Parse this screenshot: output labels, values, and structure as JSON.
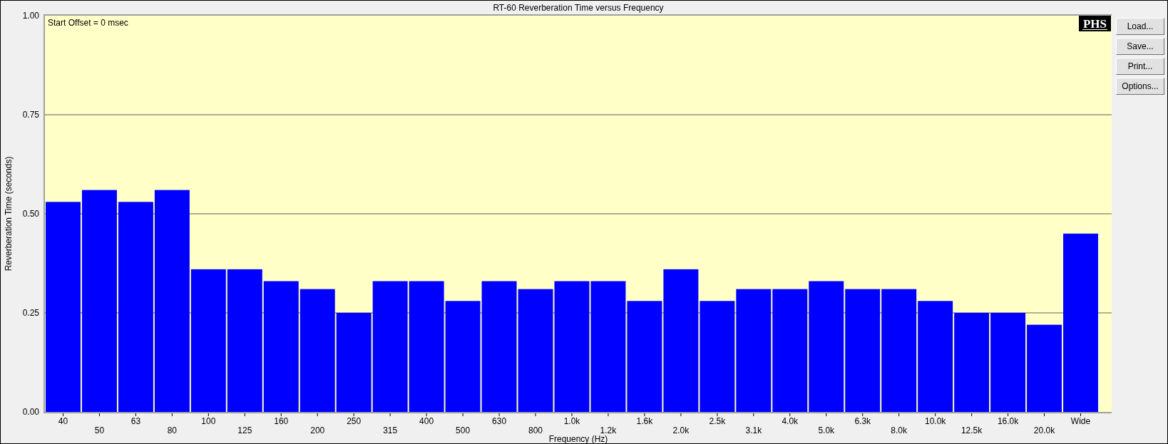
{
  "chart": {
    "logo": "PHS",
    "chart_data": {
      "type": "bar",
      "title": "RT-60 Reverberation Time versus Frequency",
      "xlabel": "Frequency (Hz)",
      "ylabel": "Reverberation Time (seconds)",
      "categories": [
        "40",
        "50",
        "63",
        "80",
        "100",
        "125",
        "160",
        "200",
        "250",
        "315",
        "400",
        "500",
        "630",
        "800",
        "1.0k",
        "1.2k",
        "1.6k",
        "2.0k",
        "2.5k",
        "3.1k",
        "4.0k",
        "5.0k",
        "6.3k",
        "8.0k",
        "10.0k",
        "12.5k",
        "16.0k",
        "20.0k",
        "Wide"
      ],
      "series": [
        {
          "color": "#0000ff",
          "values": [
            0.53,
            0.56,
            0.53,
            0.56,
            0.36,
            0.36,
            0.33,
            0.31,
            0.25,
            0.33,
            0.33,
            0.28,
            0.33,
            0.31,
            0.33,
            0.33,
            0.28,
            0.36,
            0.28,
            0.31,
            0.31,
            0.33,
            0.31,
            0.31,
            0.28,
            0.25,
            0.25,
            0.22,
            0.45
          ]
        }
      ],
      "ylim": [
        0,
        1
      ],
      "grid": true,
      "yticks": [
        {
          "value": 0,
          "label": "0.00"
        },
        {
          "value": 0.25,
          "label": "0.25"
        },
        {
          "value": 0.5,
          "label": "0.50"
        },
        {
          "value": 0.75,
          "label": "0.75"
        },
        {
          "value": 1,
          "label": "1.00"
        }
      ],
      "annotations": [
        "Start Offset = 0 msec"
      ]
    }
  },
  "buttons": [
    {
      "label": "Load..."
    },
    {
      "label": "Save..."
    },
    {
      "label": "Print..."
    },
    {
      "label": "Options..."
    }
  ]
}
